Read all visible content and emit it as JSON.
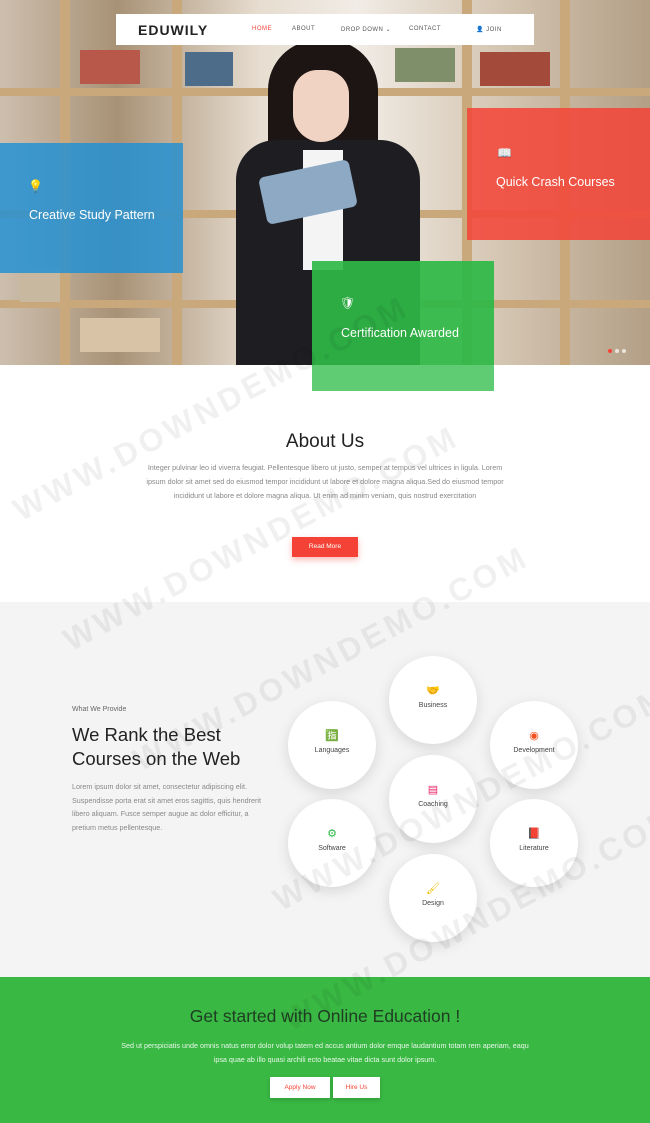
{
  "brand": "EDUWILY",
  "nav": {
    "home": "HOME",
    "about": "ABOUT",
    "dropdown": "DROP DOWN",
    "dropdown_arrow": "⌄",
    "contact": "CONTACT",
    "join": "JOIN",
    "join_icon": "👤"
  },
  "hero": {
    "features": {
      "creative": {
        "icon": "💡",
        "title": "Creative Study Pattern"
      },
      "crash": {
        "icon": "📖",
        "title": "Quick Crash Courses"
      },
      "cert": {
        "icon": "🛡",
        "title": "Certification Awarded"
      }
    }
  },
  "about": {
    "title": "About Us",
    "text": "Integer pulvinar leo id viverra feugiat. Pellentesque libero ut justo, semper at tempus vel ultrices in ligula. Lorem ipsum dolor sit amet sed do eiusmod tempor incididunt ut labore et dolore magna aliqua.Sed do eiusmod tempor incididunt ut labore et dolore magna aliqua. Ut enim ad minim veniam, quis nostrud exercitation",
    "button": "Read More"
  },
  "services": {
    "kicker": "What We Provide",
    "title": "We Rank the Best Courses on the Web",
    "text": "Lorem ipsum dolor sit amet, consectetur adipiscing elit. Suspendisse porta erat sit amet eros sagittis, quis hendrerit libero aliquam. Fusce semper augue ac dolor efficitur, a pretium metus pellentesque.",
    "items": {
      "business": {
        "label": "Business",
        "icon": "🤝",
        "color": "#2aa9d6"
      },
      "languages": {
        "label": "Languages",
        "icon": "🈯",
        "color": "#f44336"
      },
      "development": {
        "label": "Development",
        "icon": "◉",
        "color": "#f4511e"
      },
      "coaching": {
        "label": "Coaching",
        "icon": "▤",
        "color": "#e91e63"
      },
      "software": {
        "label": "Software",
        "icon": "⚙",
        "color": "#2eb846"
      },
      "literature": {
        "label": "Literature",
        "icon": "📕",
        "color": "#7b3f98"
      },
      "design": {
        "label": "Design",
        "icon": "🖌",
        "color": "#f4c20d"
      }
    }
  },
  "cta": {
    "title": "Get started with Online Education !",
    "text": "Sed ut perspiciatis unde omnis natus error dolor volup tatem ed accus antium dolor emque laudantium totam rem aperiam, eaqu ipsa quae ab illo quasi archili ecto beatae vitae dicta sunt dolor ipsum.",
    "apply": "Apply Now",
    "hire": "Hire Us"
  },
  "watermark": "WWW.DOWNDEMO.COM",
  "colors": {
    "accent": "#f44336",
    "green": "#39b843",
    "blue": "#1e90d6"
  }
}
